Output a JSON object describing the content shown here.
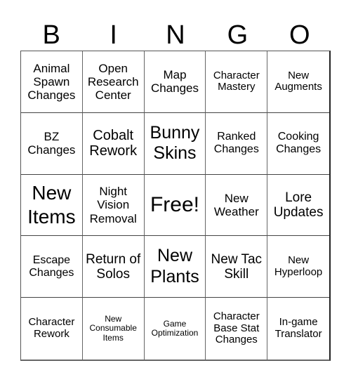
{
  "header": {
    "letters": [
      "B",
      "I",
      "N",
      "G",
      "O"
    ]
  },
  "cells": [
    "Animal Spawn Changes",
    "Open Research Center",
    "Map Changes",
    "Character Mastery",
    "New Augments",
    "BZ Changes",
    "Cobalt Rework",
    "Bunny Skins",
    "Ranked Changes",
    "Cooking Changes",
    "New Items",
    "Night Vision Removal",
    "Free!",
    "New Weather",
    "Lore Updates",
    "Escape Changes",
    "Return of Solos",
    "New Plants",
    "New Tac Skill",
    "New Hyperloop",
    "Character Rework",
    "New Consumable Items",
    "Game Optimization",
    "Character Base Stat Changes",
    "In-game Translator"
  ]
}
